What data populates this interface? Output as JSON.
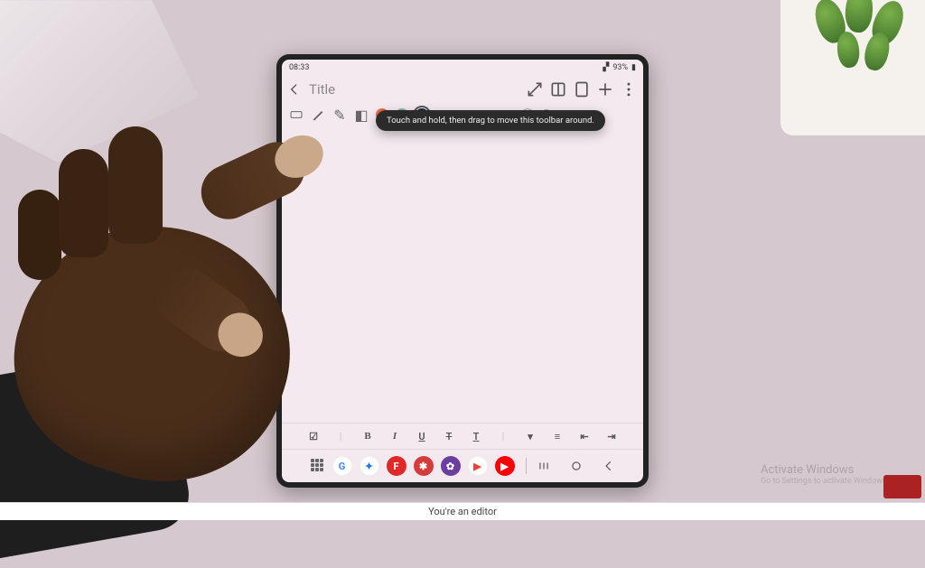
{
  "statusbar": {
    "time": "08:33",
    "battery_text": "93%"
  },
  "titlebar": {
    "title": "Title"
  },
  "tooltip": {
    "text": "Touch and hold, then drag to move this toolbar around."
  },
  "pentoolbar": {
    "swatches": [
      {
        "color": "#e86a44"
      },
      {
        "color": "#7fb8a6"
      },
      {
        "color": "#1b2a33",
        "selected": true
      }
    ]
  },
  "fmtbar": {
    "items": [
      {
        "key": "checklist",
        "glyph": "☑"
      },
      {
        "key": "divider",
        "glyph": "|"
      },
      {
        "key": "bold",
        "glyph": "B"
      },
      {
        "key": "italic",
        "glyph": "I"
      },
      {
        "key": "underline",
        "glyph": "U"
      },
      {
        "key": "strike",
        "glyph": "T̶"
      },
      {
        "key": "text-size",
        "glyph": "T"
      },
      {
        "key": "divider2",
        "glyph": "|"
      },
      {
        "key": "color",
        "glyph": "▾"
      },
      {
        "key": "align",
        "glyph": "≡"
      },
      {
        "key": "indent-dec",
        "glyph": "⇤"
      },
      {
        "key": "indent-inc",
        "glyph": "⇥"
      }
    ]
  },
  "dock": {
    "apps": [
      {
        "name": "google",
        "bg": "#ffffff",
        "fg": "#4285F4",
        "label": "G"
      },
      {
        "name": "chat",
        "bg": "#ffffff",
        "fg": "#1a73e8",
        "label": "✦"
      },
      {
        "name": "flipboard",
        "bg": "#e12828",
        "fg": "#fff",
        "label": "F"
      },
      {
        "name": "app-red",
        "bg": "#d63b3b",
        "fg": "#fff",
        "label": "✱"
      },
      {
        "name": "settings",
        "bg": "#6b3fa0",
        "fg": "#fff",
        "label": "✿"
      },
      {
        "name": "google-tv",
        "bg": "#ffffff",
        "fg": "#ea4335",
        "label": "▶"
      },
      {
        "name": "youtube",
        "bg": "#ff0000",
        "fg": "#fff",
        "label": "▶"
      }
    ]
  },
  "caption": {
    "text": "You're an editor"
  },
  "watermark": {
    "line1": "Activate Windows",
    "line2": "Go to Settings to activate Windows."
  }
}
